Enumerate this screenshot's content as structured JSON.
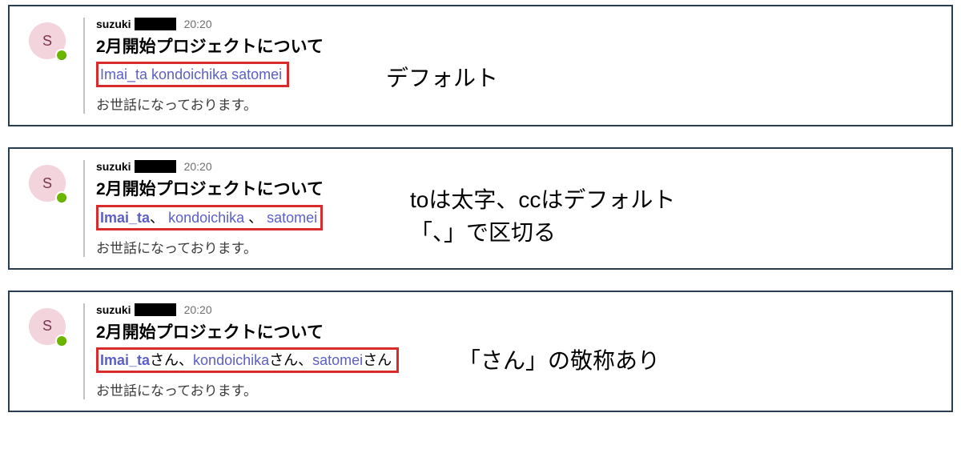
{
  "shared": {
    "sender_prefix": "suzuki",
    "avatar_letter": "S",
    "time": "20:20",
    "subject": "2月開始プロジェクトについて",
    "body": "お世話になっております。"
  },
  "cards": {
    "a": {
      "annotation": "デフォルト",
      "mentions": {
        "m1": "Imai_ta",
        "m2": "kondoichika",
        "m3": "satomei"
      }
    },
    "b": {
      "annotation": "toは太字、ccはデフォルト\n「、」で区切る",
      "sep": "、",
      "mentions": {
        "m1": "Imai_ta",
        "m2": "kondoichika",
        "m3": "satomei"
      }
    },
    "c": {
      "annotation": "「さん」の敬称あり",
      "sep": "さん、",
      "tail": "さん",
      "mentions": {
        "m1": "Imai_ta",
        "m2": "kondoichika",
        "m3": "satomei"
      }
    }
  }
}
